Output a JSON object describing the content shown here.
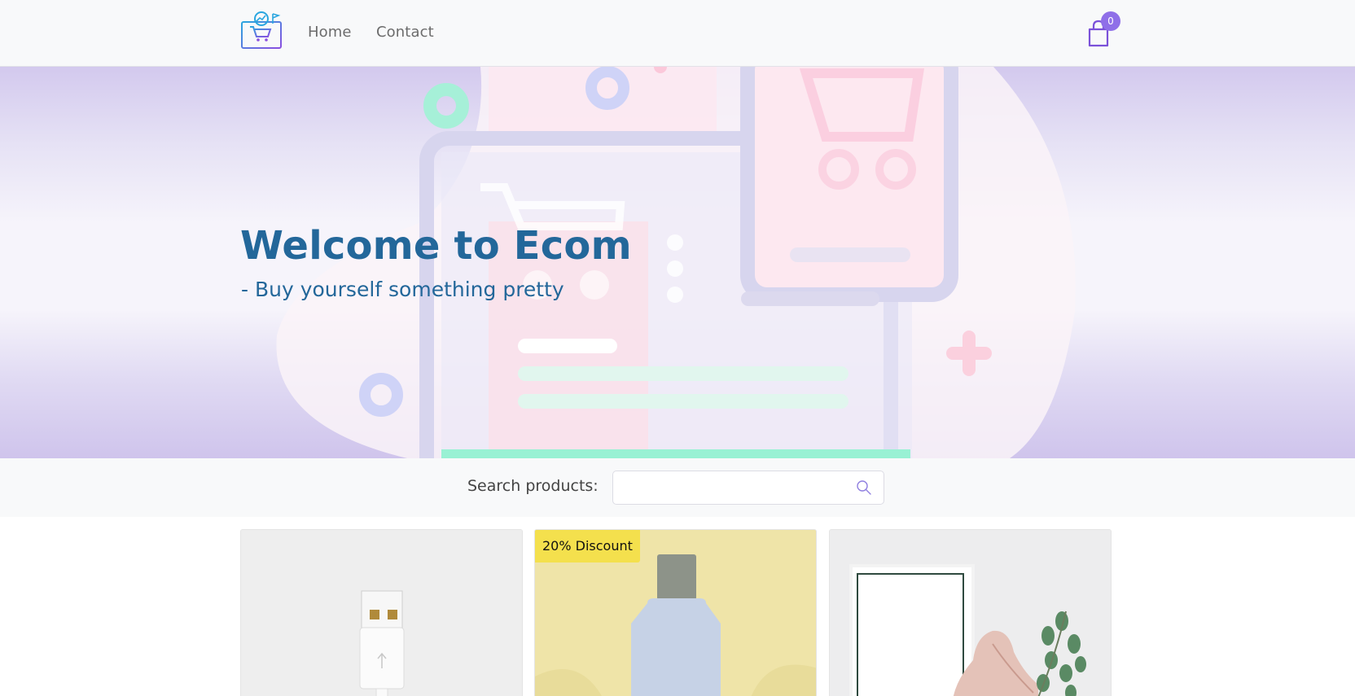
{
  "navbar": {
    "logo_icon": "shopping-cart-monitor-icon",
    "links": [
      {
        "label": "Home"
      },
      {
        "label": "Contact"
      }
    ],
    "cart": {
      "icon": "shopping-bag-icon",
      "count": "0"
    }
  },
  "hero": {
    "title": "Welcome to Ecom",
    "subtitle": "- Buy yourself something pretty"
  },
  "search": {
    "label": "Search products:",
    "value": "",
    "placeholder": "",
    "icon": "search-icon"
  },
  "products": [
    {
      "image": "usb-cable-image",
      "badge": ""
    },
    {
      "image": "lotion-bottle-image",
      "badge": "20% Discount"
    },
    {
      "image": "shoes-and-frame-image",
      "badge": ""
    }
  ],
  "colors": {
    "accent": "#8f6fe8",
    "hero_text": "#23679a",
    "badge": "#f4e04d",
    "navbar_bg": "#f8f9fa"
  }
}
